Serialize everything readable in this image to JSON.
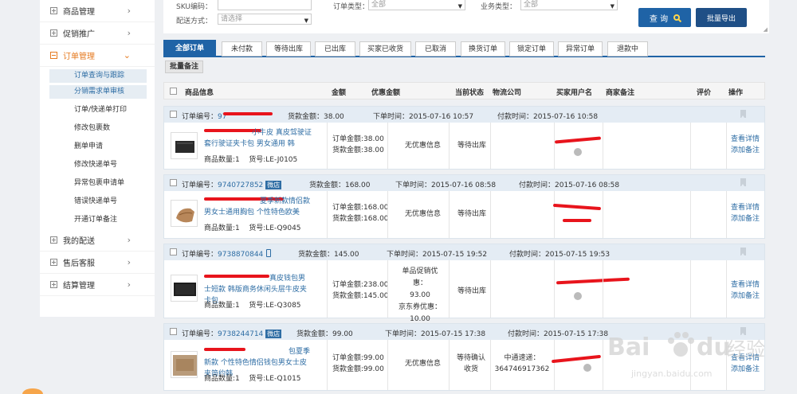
{
  "sidebar": {
    "groups": [
      {
        "label": "商品管理",
        "open": false
      },
      {
        "label": "促销推广",
        "open": false
      },
      {
        "label": "订单管理",
        "open": true
      }
    ],
    "order_items": [
      "订单查询与跟踪",
      "分销需求单审核",
      "订单/快递单打印",
      "修改包裹数",
      "删单申请",
      "修改快递单号",
      "异常包裹申请单",
      "错误快递单号",
      "开通订单备注"
    ],
    "after_groups": [
      {
        "label": "我的配送"
      },
      {
        "label": "售后客服"
      },
      {
        "label": "结算管理"
      }
    ]
  },
  "filters": {
    "sku_label": "SKU编码：",
    "sku_value": "",
    "ship_label": "配送方式：",
    "ship_value": "请选择",
    "order_type_label": "订单类型：",
    "order_type_value": "全部",
    "biz_type_label": "业务类型：",
    "biz_type_value": "全部",
    "query_label": "查 询",
    "export_label": "批量导出"
  },
  "tabs": [
    "全部订单",
    "未付款",
    "等待出库",
    "已出库",
    "买家已收货",
    "已取消",
    "换货订单",
    "锁定订单",
    "异常订单",
    "退款中"
  ],
  "batch_note": "批量备注",
  "table_headers": {
    "product": "商品信息",
    "amount": "金额",
    "discount": "优惠金额",
    "status": "当前状态",
    "logistics": "物流公司",
    "buyer": "买家用户名",
    "remark": "商家备注",
    "rating": "评价",
    "action": "操作"
  },
  "orders": [
    {
      "order_no_label": "订单编号：",
      "order_no": "97",
      "goods_amount": "货款金额：38.00",
      "order_time": "下单时间：2015-07-16 10:57",
      "pay_time": "付款时间：2015-07-16 10:58",
      "product_name": "小牛皮 真皮驾驶证套行驶证夹卡包 男女通用 韩",
      "qty": "商品数量:1",
      "sku": "货号:LE-J0105",
      "order_amount": "订单金额:38.00",
      "goods_amount2": "货款金额:38.00",
      "discount": "无优惠信息",
      "status": "等待出库",
      "logistics": "",
      "view": "查看详情",
      "add_remark": "添加备注"
    },
    {
      "order_no_label": "订单编号：",
      "order_no": "9740727852",
      "tag": "微店",
      "goods_amount": "货款金额：168.00",
      "order_time": "下单时间：2015-07-16 08:58",
      "pay_time": "付款时间：2015-07-16 08:58",
      "product_name": "夏季新款情侣款男女士通用胸包 个性特色欧美",
      "qty": "商品数量:1",
      "sku": "货号:LE-Q9045",
      "order_amount": "订单金额:168.00",
      "goods_amount2": "货款金额:168.00",
      "discount": "无优惠信息",
      "status": "等待出库",
      "logistics": "",
      "view": "查看详情",
      "add_remark": "添加备注"
    },
    {
      "order_no_label": "订单编号：",
      "order_no": "9738870844",
      "goods_amount": "货款金额：145.00",
      "order_time": "下单时间：2015-07-15 19:52",
      "pay_time": "付款时间：2015-07-15 19:53",
      "product_name": "真皮钱包男士短款 韩版商务休闲头层牛皮夹卡包",
      "qty": "商品数量:1",
      "sku": "货号:LE-Q3085",
      "order_amount": "订单金额:238.00",
      "goods_amount2": "货款金额:145.00",
      "discount_lines": [
        "单品促销优惠：",
        "93.00",
        "京东券优惠：",
        "10.00"
      ],
      "status": "等待出库",
      "logistics": "",
      "view": "查看详情",
      "add_remark": "添加备注"
    },
    {
      "order_no_label": "订单编号：",
      "order_no": "9738244714",
      "tag": "微店",
      "goods_amount": "货款金额：99.00",
      "order_time": "下单时间：2015-07-15 17:38",
      "pay_time": "付款时间：2015-07-15 17:38",
      "product_name": "包夏季新款 个性特色情侣钱包男女士皮夹简约韩",
      "qty": "商品数量:1",
      "sku": "货号:LE-Q1015",
      "order_amount": "订单金额:99.00",
      "goods_amount2": "货款金额:99.00",
      "discount": "无优惠信息",
      "status_lines": [
        "等待确认",
        "收货"
      ],
      "logistics_lines": [
        "中通速递：",
        "364746917362"
      ],
      "view": "查看详情",
      "add_remark": "添加备注"
    }
  ],
  "watermark": {
    "brand": "Bai",
    "paw": "du",
    "cn": "经验",
    "url": "jingyan.baidu.com"
  },
  "colors": {
    "primary": "#1f63a6",
    "accent": "#e57a20",
    "link": "#2e6da4",
    "redact": "#e8141c"
  }
}
